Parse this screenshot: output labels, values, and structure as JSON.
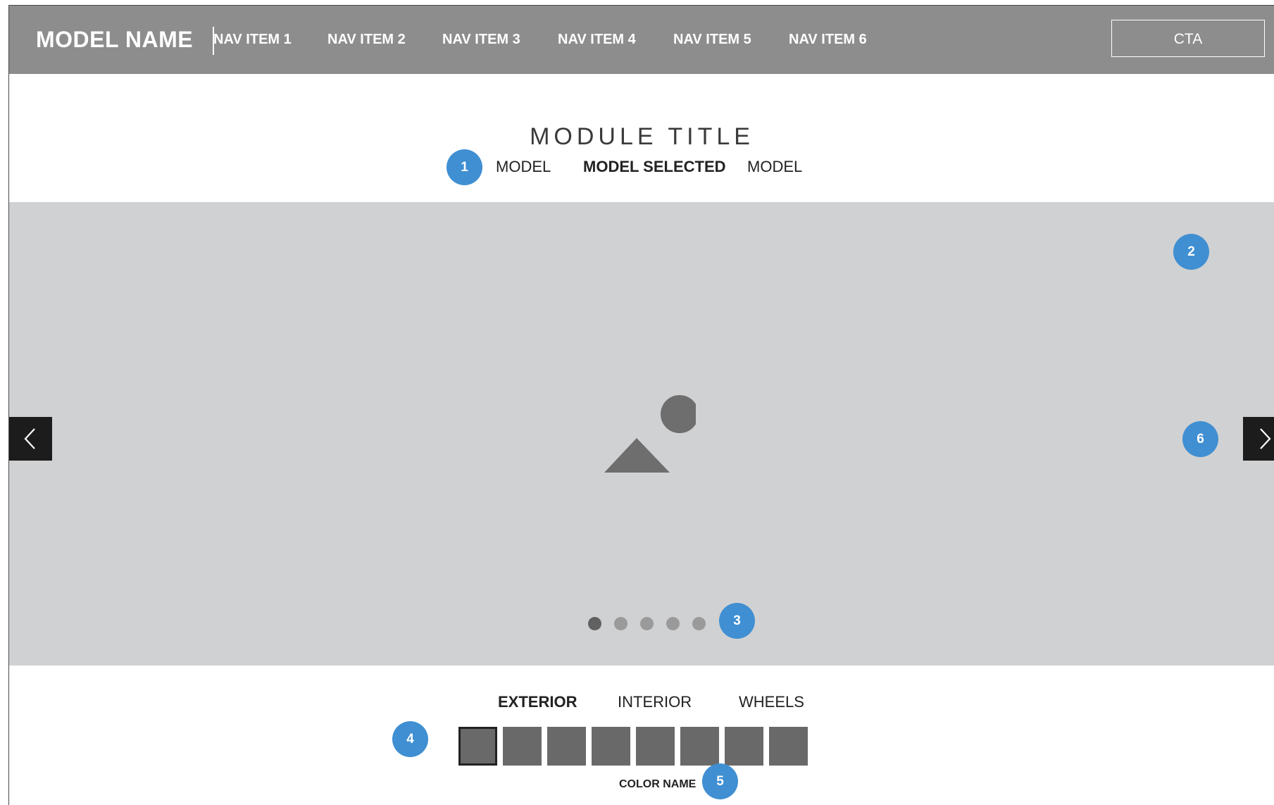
{
  "header": {
    "model_name": "MODEL NAME",
    "nav": [
      {
        "label": "NAV ITEM 1"
      },
      {
        "label": "NAV ITEM 2"
      },
      {
        "label": "NAV ITEM 3"
      },
      {
        "label": "NAV ITEM 4"
      },
      {
        "label": "NAV ITEM 5"
      },
      {
        "label": "NAV ITEM 6"
      }
    ],
    "cta_label": "CTA"
  },
  "module": {
    "title": "MODULE TITLE",
    "models": [
      {
        "label": "MODEL",
        "selected": false
      },
      {
        "label": "MODEL SELECTED",
        "selected": true
      },
      {
        "label": "MODEL",
        "selected": false
      }
    ]
  },
  "carousel": {
    "slide_count": 5,
    "active_slide": 1,
    "prev_icon": "chevron-left-icon",
    "next_icon": "chevron-right-icon",
    "image_icon": "image-placeholder-icon"
  },
  "configurator": {
    "tabs": [
      {
        "label": "EXTERIOR",
        "selected": true
      },
      {
        "label": "INTERIOR",
        "selected": false
      },
      {
        "label": "WHEELS",
        "selected": false
      }
    ],
    "swatch_count": 8,
    "selected_swatch": 1,
    "color_name": "COLOR NAME"
  },
  "annotations": [
    "1",
    "2",
    "3",
    "4",
    "5",
    "6"
  ],
  "colors": {
    "header_bg": "#8e8d8e",
    "stage_bg": "#d0d1d3",
    "badge": "#3f8fd2",
    "arrow_bg": "#1c1c1c",
    "swatch": "#696969"
  }
}
